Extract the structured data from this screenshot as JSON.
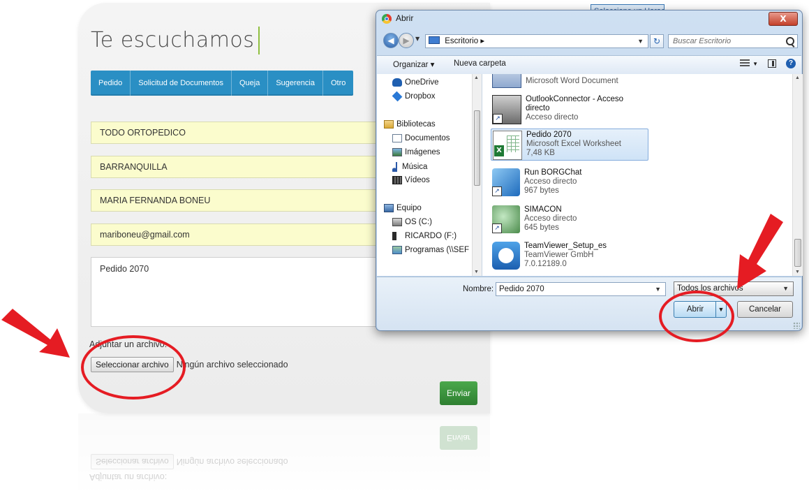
{
  "form": {
    "title": "Te escuchamos",
    "tabs": [
      "Pedido",
      "Solicitud de Documentos",
      "Queja",
      "Sugerencia",
      "Otro"
    ],
    "fields": {
      "company": "TODO ORTOPEDICO",
      "city": "BARRANQUILLA",
      "name": "MARIA FERNANDA BONEU",
      "email": "mariboneu@gmail.com",
      "message": "Pedido 2070"
    },
    "attach_label": "Adjuntar un archivo:",
    "file_button": "Seleccionar archivo",
    "file_status": "Ningún archivo seleccionado",
    "send_button": "Enviar",
    "accent_color": "#2a8fc4",
    "send_color": "#2e7f31",
    "field_bg": "#fbfccd"
  },
  "background": {
    "partial_text": "Seleccione un Harae"
  },
  "dialog": {
    "title": "Abrir",
    "close_label": "X",
    "address": "Escritorio",
    "search_placeholder": "Buscar Escritorio",
    "toolbar": {
      "organize": "Organizar ▾",
      "new_folder": "Nueva carpeta"
    },
    "nav": {
      "onedrive": "OneDrive",
      "dropbox": "Dropbox",
      "libraries": "Bibliotecas",
      "documents": "Documentos",
      "images": "Imágenes",
      "music": "Música",
      "videos": "Vídeos",
      "computer": "Equipo",
      "drive_c": "OS (C:)",
      "drive_f": "RICARDO (F:)",
      "network": "Programas (\\\\SEF"
    },
    "files": [
      {
        "name": "",
        "line2": "Microsoft Word Document",
        "line3": "",
        "icon": "word-icon"
      },
      {
        "name": "OutlookConnector - Acceso directo",
        "line2": "Acceso directo",
        "line3": "",
        "icon": "outlook-connector-icon"
      },
      {
        "name": "Pedido 2070",
        "line2": "Microsoft Excel Worksheet",
        "line3": "7,48 KB",
        "icon": "excel-icon",
        "selected": true
      },
      {
        "name": "Run BORGChat",
        "line2": "Acceso directo",
        "line3": "967 bytes",
        "icon": "cube-icon"
      },
      {
        "name": "SIMACON",
        "line2": "Acceso directo",
        "line3": "645 bytes",
        "icon": "simacon-icon"
      },
      {
        "name": "TeamViewer_Setup_es",
        "line2": "TeamViewer GmbH",
        "line3": "7.0.12189.0",
        "icon": "teamviewer-icon"
      }
    ],
    "filename_label": "Nombre:",
    "filename_value": "Pedido 2070",
    "filetype_value": "Todos los archivos",
    "open_button": "Abrir",
    "cancel_button": "Cancelar"
  },
  "annotations": {
    "color": "#e51c23"
  }
}
